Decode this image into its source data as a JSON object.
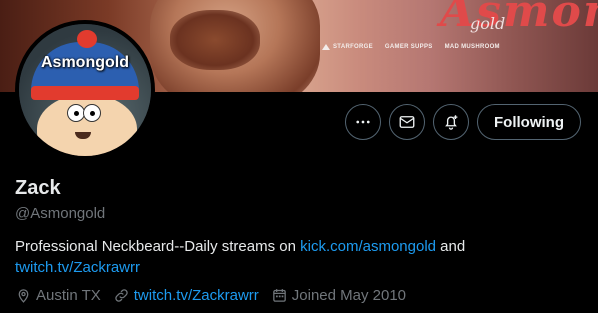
{
  "banner": {
    "logo_text": "Asmon",
    "logo_sub": "gold",
    "sponsors": [
      "STARFORGE",
      "GAMER SUPPS",
      "MAD MUSHROOM"
    ]
  },
  "avatar": {
    "label": "Asmongold"
  },
  "actions": {
    "more_icon": "more-icon",
    "message_icon": "envelope-icon",
    "notify_icon": "bell-plus-icon",
    "follow_label": "Following"
  },
  "profile": {
    "display_name": "Zack",
    "handle": "@Asmongold",
    "bio_text_1": "Professional Neckbeard--Daily streams on ",
    "bio_link_1": "kick.com/asmongold",
    "bio_text_2": " and",
    "bio_link_2": "twitch.tv/Zackrawrr"
  },
  "meta": {
    "location": "Austin TX",
    "website": "twitch.tv/Zackrawrr",
    "joined": "Joined May 2010",
    "location_icon": "location-pin-icon",
    "link_icon": "link-icon",
    "calendar_icon": "calendar-icon"
  },
  "colors": {
    "background": "#000000",
    "link": "#1d9bf0",
    "secondary_text": "#71767b",
    "primary_text": "#e7e9ea",
    "button_border": "#536471"
  }
}
